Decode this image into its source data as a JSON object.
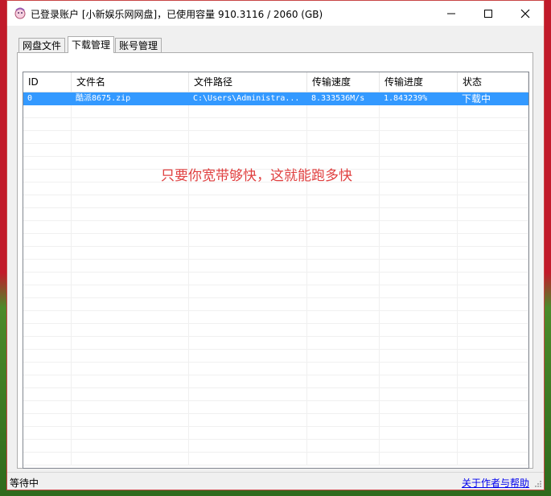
{
  "window": {
    "title": "已登录账户 [小新娱乐网网盘]，已使用容量 910.3116 / 2060 (GB)",
    "icon": "app-icon",
    "controls": [
      "minimize-icon",
      "maximize-icon",
      "close-icon"
    ]
  },
  "tabs": [
    {
      "label": "网盘文件",
      "active": false
    },
    {
      "label": "下载管理",
      "active": true
    },
    {
      "label": "账号管理",
      "active": false
    }
  ],
  "table": {
    "columns": [
      "ID",
      "文件名",
      "文件路径",
      "传输速度",
      "传输进度",
      "状态"
    ],
    "rows": [
      {
        "id": "0",
        "filename": "酷派8675.zip",
        "path": "C:\\Users\\Administra...",
        "speed": "8.333536M/s",
        "progress": "1.843239%",
        "status": "下载中",
        "selected": true
      }
    ]
  },
  "overlay_text": "只要你宽带够快，这就能跑多快",
  "statusbar": {
    "status": "等待中",
    "help_link": "关于作者与帮助"
  },
  "colors": {
    "selection": "#3399ff",
    "overlay_text": "#e04040",
    "link": "#0000ee",
    "window_border": "#c84545"
  }
}
